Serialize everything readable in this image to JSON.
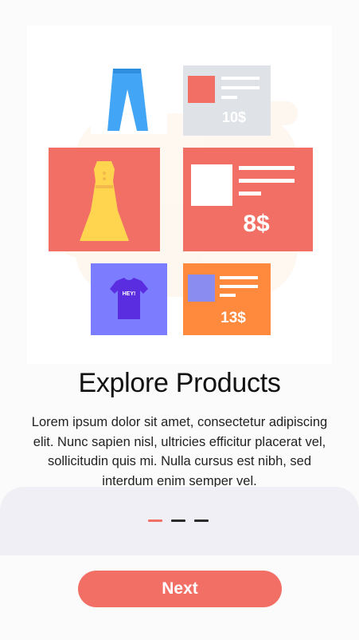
{
  "illustration": {
    "price_small": "13$",
    "price_large": "8$",
    "price_faded": "10$",
    "shirt_text": "HEY!",
    "colors": {
      "jeans": "#42a5f5",
      "dress": "#ffd54f",
      "red_card": "#f26f65",
      "purple_card": "#7c7cff",
      "orange_card": "#ff8a3d",
      "grey_card": "#dfe3e8"
    }
  },
  "onboarding": {
    "title": "Explore Products",
    "description": "Lorem ipsum dolor sit amet, consectetur adipiscing elit. Nunc sapien nisl, ultricies efficitur placerat vel, sollicitudin quis mi. Nulla cursus est nibh, sed interdum enim semper vel.",
    "page_count": 3,
    "current_page": 1
  },
  "actions": {
    "next_label": "Next"
  },
  "theme": {
    "accent": "#f26f65"
  }
}
